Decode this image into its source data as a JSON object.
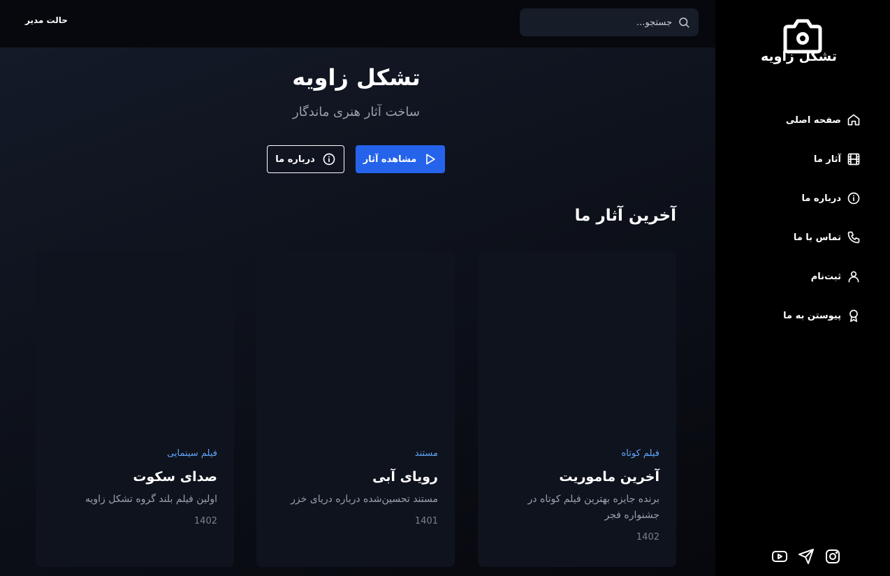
{
  "topbar": {
    "admin_label": "حالت مدیر",
    "search_placeholder": "جستجو..."
  },
  "sidebar": {
    "brand_name": "تشکل زاویه",
    "logo_icon": "camera-icon",
    "items": [
      {
        "label": "صفحه اصلی",
        "icon": "home-icon"
      },
      {
        "label": "آثار ما",
        "icon": "film-icon"
      },
      {
        "label": "درباره ما",
        "icon": "info-icon"
      },
      {
        "label": "تماس با ما",
        "icon": "phone-icon"
      },
      {
        "label": "ثبت‌نام",
        "icon": "user-icon"
      },
      {
        "label": "پیوستن به ما",
        "icon": "award-icon"
      }
    ],
    "socials": [
      "instagram-icon",
      "telegram-icon",
      "youtube-icon"
    ]
  },
  "hero": {
    "title": "تشکل زاویه",
    "subtitle": "ساخت آثار هنری ماندگار",
    "primary_button": "مشاهده آثار",
    "secondary_button": "درباره ما"
  },
  "latest": {
    "title": "آخرین آثار ما",
    "cards": [
      {
        "category": "فیلم کوتاه",
        "title": "آخرین ماموریت",
        "description": "برنده جایزه بهترین فیلم کوتاه در جشنواره فجر",
        "year": "1402"
      },
      {
        "category": "مستند",
        "title": "رویای آبی",
        "description": "مستند تحسین‌شده درباره دریای خزر",
        "year": "1401"
      },
      {
        "category": "فیلم سینمایی",
        "title": "صدای سکوت",
        "description": "اولین فیلم بلند گروه تشکل زاویه",
        "year": "1402"
      }
    ]
  },
  "colors": {
    "accent": "#2563eb",
    "category_text": "#60a5fa",
    "sidebar_bg": "#000000",
    "card_bg": "#0f131d"
  }
}
